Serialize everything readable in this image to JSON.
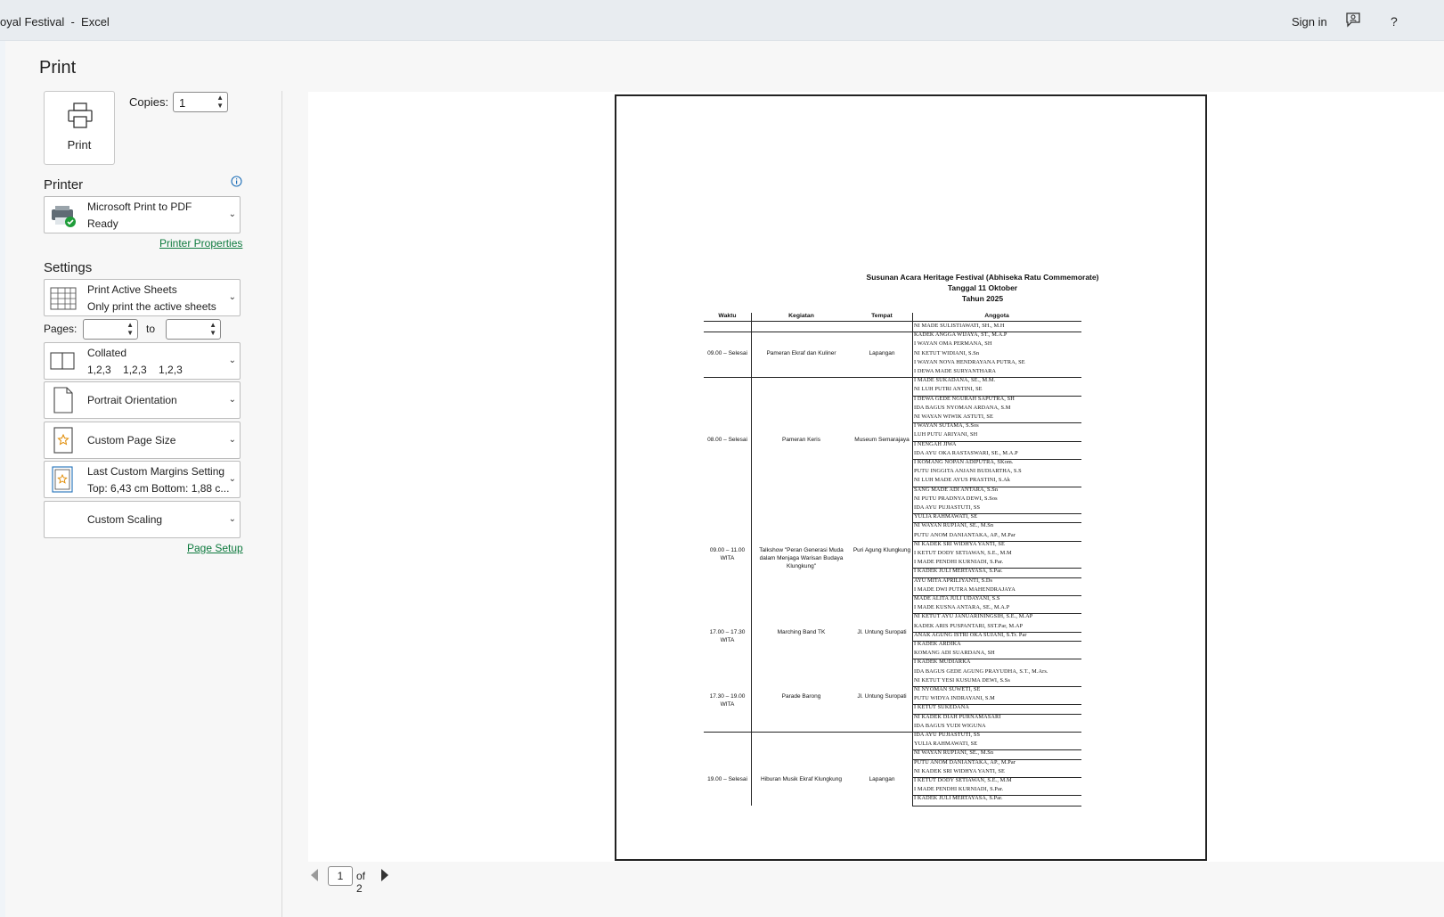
{
  "titlebar": {
    "title": "oyal Festival  -  Excel",
    "sign_in": "Sign in",
    "help": "?"
  },
  "print": {
    "heading": "Print",
    "print_button": "Print",
    "copies_label": "Copies:",
    "copies_value": "1"
  },
  "printer": {
    "heading": "Printer",
    "name": "Microsoft Print to PDF",
    "status": "Ready",
    "properties_link": "Printer Properties"
  },
  "settings": {
    "heading": "Settings",
    "sheets": {
      "title": "Print Active Sheets",
      "subtitle": "Only print the active sheets"
    },
    "pages_label": "Pages:",
    "pages_from": "",
    "to_label": "to",
    "pages_to": "",
    "collation": {
      "title": "Collated",
      "subtitle": "1,2,3    1,2,3    1,2,3"
    },
    "orientation": {
      "title": "Portrait Orientation"
    },
    "page_size": {
      "title": "Custom Page Size"
    },
    "margins": {
      "title": "Last Custom Margins Setting",
      "subtitle": "Top: 6,43 cm Bottom: 1,88 c..."
    },
    "scaling": {
      "title": "Custom Scaling"
    },
    "page_setup_link": "Page Setup"
  },
  "navigation": {
    "current_page": "1",
    "of_pages": "of 2"
  },
  "document": {
    "title_lines": [
      "Susunan Acara Heritage Festival (Abhiseka Ratu Commemorate)",
      "Tanggal 11 Oktober",
      "Tahun 2025"
    ],
    "headers": {
      "waktu": "Waktu",
      "kegiatan": "Kegiatan",
      "tempat": "Tempat",
      "anggota": "Anggota"
    },
    "events": [
      {
        "waktu": "09.00 – Selesai",
        "kegiatan": "Pameran Ekraf dan Kuliner",
        "tempat": "Lapangan"
      },
      {
        "waktu": "08.00 – Selesai",
        "kegiatan": "Pameran Keris",
        "tempat": "Museum Semarajaya"
      },
      {
        "waktu": "09.00 – 11.00 WITA",
        "kegiatan": "Talkshow \"Peran Generasi Muda dalam Menjaga Warisan Budaya Klungkung\"",
        "tempat": "Puri Agung Klungkung"
      },
      {
        "waktu": "17.00 – 17.30 WITA",
        "kegiatan": "Marching Band TK",
        "tempat": "Jl. Untung Suropati"
      },
      {
        "waktu": "17.30 – 19.00 WITA",
        "kegiatan": "Parade Barong",
        "tempat": "Jl. Untung Suropati"
      },
      {
        "waktu": "19.00 – Selesai",
        "kegiatan": "Hiburan Musik Ekraf Klungkung",
        "tempat": "Lapangan"
      }
    ],
    "members": [
      "NI MADE SULISTIAWATI, SH., M.H",
      "KADEK ANGGA WIJAYA, ST., M.A.P",
      "I WAYAN OMA PERMANA, SH",
      "NI KETUT WIDIANI, S.Sn",
      "I WAYAN NOVA HENDRAYANA PUTRA, SE",
      " I DEWA MADE SURYANTHARA",
      "I MADE SUKADANA, SE., M.M.",
      "NI LUH PUTRI ANTINI, SE",
      "I DEWA GEDE NGURAH SAPUTRA, SH",
      "IDA BAGUS NYOMAN ARDANA, S.M",
      "NI WAYAN WIWIK ASTUTI, SE",
      "I WAYAN SUTAMA, S.Sos",
      "LUH PUTU ARIYANI, SH",
      "I NENGAH JIWA",
      "IDA AYU OKA RASTASWARI, SE., M.A.P",
      "I KOMANG NOPAN ADIPUTRA,   SKom.",
      "PUTU INGGITA ANJANI BUDIARTHA, S.S",
      "NI LUH MADE AYUS PRASTINI, S.Ak",
      "SANG MADE ADI ANTARA, S.Sn",
      "NI PUTU PRADNYA DEWI, S.Sos",
      "IDA AYU PUJIASTUTI, SS",
      "YULIA RAHMAWATI, SE",
      "NI WAYAN RUPIANI, SE., M.Sn",
      "PUTU ANOM DANIANTAKA, AP., M.Par",
      "NI KADEK SRI WIDHYA YANTI, SE",
      "I KETUT DODY SETIAWAN, S.E., M.M",
      "I MADE PENDHI KURNIADI,   S.Par.",
      "I KADEK JULI MERTAYASA, S.Par.",
      "AYU MITA APRILIYANTI, S.Ds",
      "I MADE DWI PUTRA MAHENDRAJAYA",
      "MADE ALITA JULI UDAYANI, S.S",
      "I MADE KUSNA ANTARA, SE., M.A.P",
      "NI KETUT AYU JANUARININGSIH, S.E., M.AP",
      "KADEK ARIS PUSPANTARI, SST.Par, M.AP",
      "ANAK AGUNG ISTRI OKA SUJANI,   S.Tr. Par",
      "I KADEK ARDIKA",
      "KOMANG ADI SUARDANA, SH",
      "I KADEK MUDIARKA",
      "IDA BAGUS GEDE AGUNG PRAYUDHA, S.T., M.Ars.",
      "NI KETUT YESI KUSUMA DEWI, S.Ss",
      "NI NYOMAN SUWETI, SE",
      "PUTU WIDYA INDRAYANI, S.M",
      "I KETUT SUKEDANA",
      "NI KADEK DIAH PURNAMASARI",
      "IDA BAGUS YUDI WIGUNA",
      "IDA AYU PUJIASTUTI, SS",
      "YULIA RAHMAWATI, SE",
      "NI WAYAN RUPIANI, SE., M.Sn",
      "PUTU ANOM DANIANTAKA, AP., M.Par",
      "NI KADEK SRI WIDHYA YANTI, SE",
      "I KETUT DODY SETIAWAN, S.E., M.M",
      "I MADE PENDHI KURNIADI,   S.Par.",
      "I KADEK JULI MERTAYASA, S.Par."
    ]
  }
}
